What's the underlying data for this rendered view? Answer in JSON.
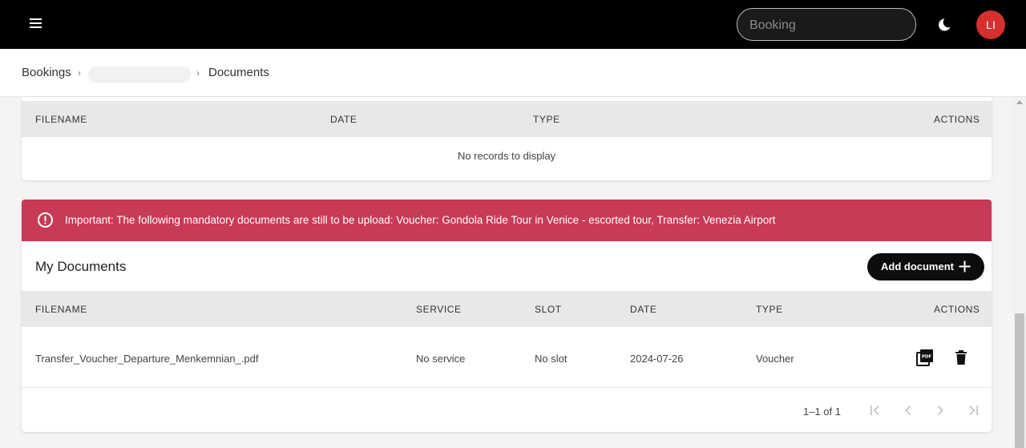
{
  "topbar": {
    "menu_icon": "hamburger-menu-icon",
    "search_placeholder": "Booking",
    "theme_icon": "moon-icon",
    "avatar_initials": "LI",
    "avatar_color": "#d3302f"
  },
  "breadcrumb": {
    "root": "Bookings",
    "separator": "›",
    "current": "Documents"
  },
  "required_docs_table": {
    "columns": [
      "FILENAME",
      "DATE",
      "TYPE",
      "ACTIONS"
    ],
    "empty_message": "No records to display"
  },
  "alert": {
    "icon": "error-circle-icon",
    "message": "Important: The following mandatory documents are still to be upload: Voucher: Gondola Ride Tour in Venice - escorted tour, Transfer: Venezia Airport",
    "color": "#c83a55"
  },
  "my_documents": {
    "title": "My Documents",
    "add_button_label": "Add document",
    "columns": [
      "FILENAME",
      "SERVICE",
      "SLOT",
      "DATE",
      "TYPE",
      "ACTIONS"
    ],
    "rows": [
      {
        "filename": "Transfer_Voucher_Departure_Menkemnian_.pdf",
        "service": "No service",
        "slot": "No slot",
        "date": "2024-07-26",
        "type": "Voucher",
        "actions": [
          "pdf-icon",
          "trash-icon"
        ]
      }
    ],
    "pagination": {
      "range_text": "1–1 of 1"
    }
  }
}
